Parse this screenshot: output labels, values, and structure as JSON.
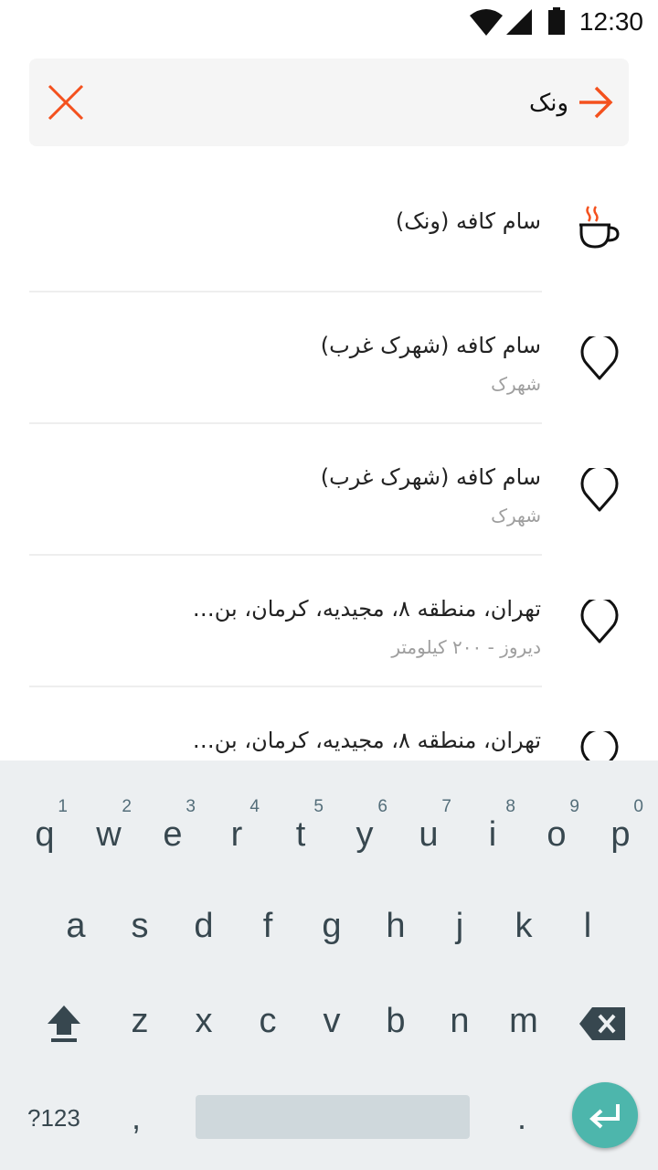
{
  "status_bar": {
    "time": "12:30",
    "icons": [
      "wifi-icon",
      "signal-icon",
      "battery-icon"
    ]
  },
  "search": {
    "value": "ونک",
    "clear_icon": "close-icon",
    "go_icon": "arrow-right-icon",
    "accent": "#f4511e"
  },
  "results": [
    {
      "icon": "coffee-cup-icon",
      "title": "سام کافه (ونک)",
      "subtitle": ""
    },
    {
      "icon": "map-pin-icon",
      "title": "سام کافه (شهرک غرب)",
      "subtitle": "شهرک"
    },
    {
      "icon": "map-pin-icon",
      "title": "سام کافه (شهرک غرب)",
      "subtitle": "شهرک"
    },
    {
      "icon": "map-pin-icon",
      "title": "تهران، منطقه ۸، مجیدیه، کرمان، بن…",
      "subtitle": "دیروز - ۲۰۰ کیلومتر"
    },
    {
      "icon": "map-pin-icon",
      "title": "تهران، منطقه ۸، مجیدیه، کرمان، بن…",
      "subtitle": ""
    }
  ],
  "keyboard": {
    "row1": [
      {
        "key": "q",
        "hint": "1"
      },
      {
        "key": "w",
        "hint": "2"
      },
      {
        "key": "e",
        "hint": "3"
      },
      {
        "key": "r",
        "hint": "4"
      },
      {
        "key": "t",
        "hint": "5"
      },
      {
        "key": "y",
        "hint": "6"
      },
      {
        "key": "u",
        "hint": "7"
      },
      {
        "key": "i",
        "hint": "8"
      },
      {
        "key": "o",
        "hint": "9"
      },
      {
        "key": "p",
        "hint": "0"
      }
    ],
    "row2": [
      "a",
      "s",
      "d",
      "f",
      "g",
      "h",
      "j",
      "k",
      "l"
    ],
    "row3": [
      "z",
      "x",
      "c",
      "v",
      "b",
      "n",
      "m"
    ],
    "symbols_label": "?123",
    "comma": ",",
    "period": ".",
    "enter_color": "#4db6ac"
  }
}
